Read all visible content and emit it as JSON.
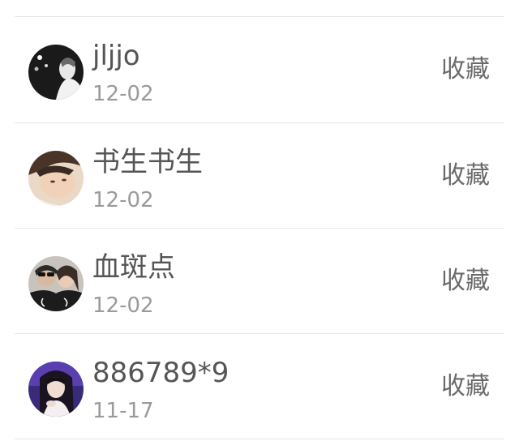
{
  "list": {
    "items": [
      {
        "name": "jljjo",
        "date": "12-02",
        "action": "收藏",
        "avatar_icon": "user-avatar"
      },
      {
        "name": "书生书生",
        "date": "12-02",
        "action": "收藏",
        "avatar_icon": "user-avatar"
      },
      {
        "name": "血斑点",
        "date": "12-02",
        "action": "收藏",
        "avatar_icon": "user-avatar"
      },
      {
        "name": "886789*9",
        "date": "11-17",
        "action": "收藏",
        "avatar_icon": "user-avatar"
      }
    ]
  },
  "colors": {
    "divider": "#e6e6e6",
    "name_text": "#555555",
    "date_text": "#9a9a9a",
    "action_text": "#6a6a6a"
  }
}
